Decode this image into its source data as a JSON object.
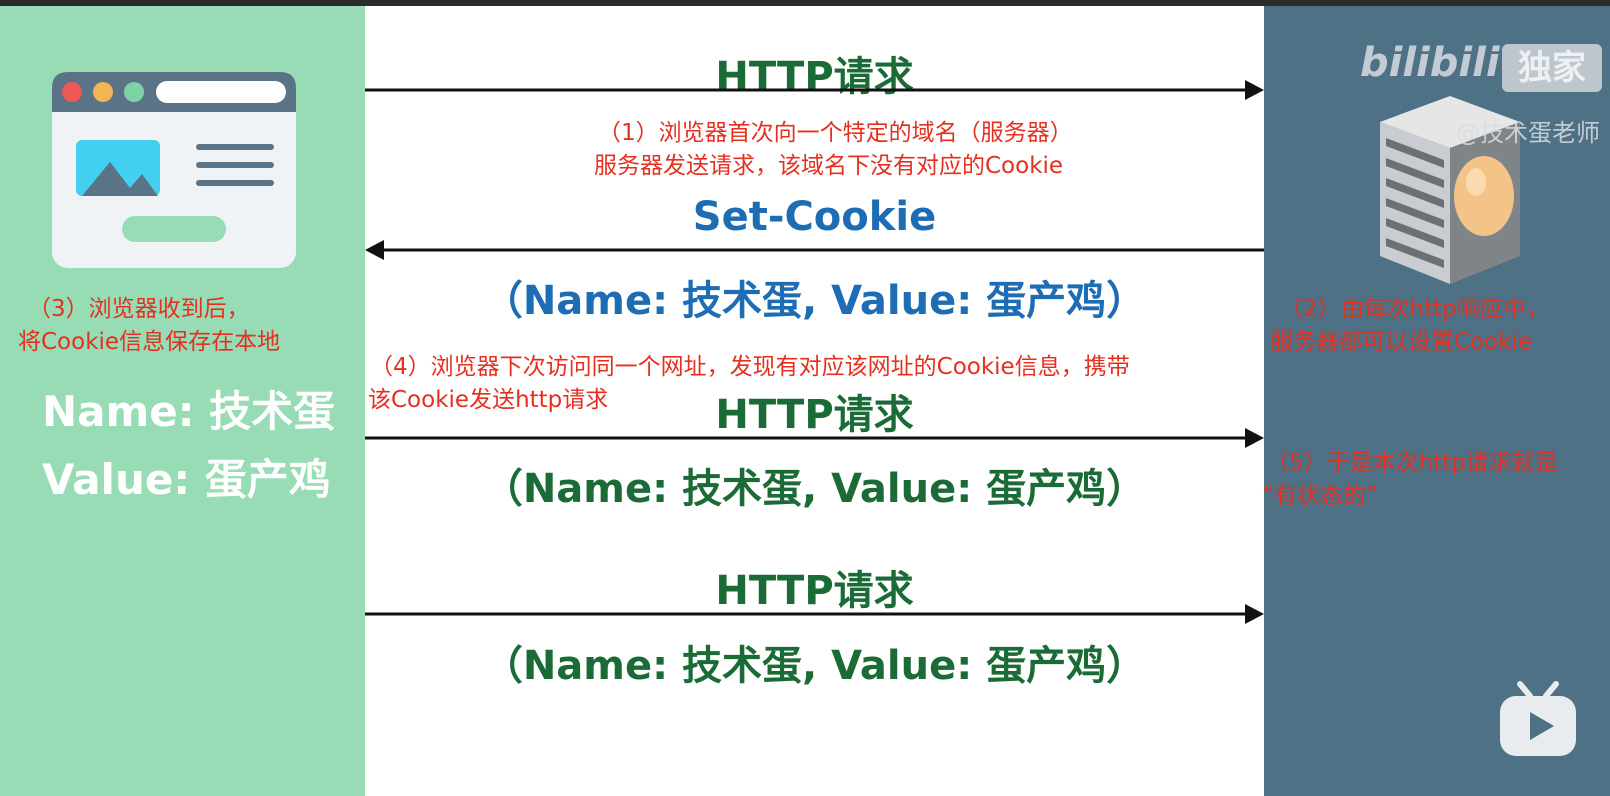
{
  "steps": {
    "step1_line1": "（1）浏览器首次向一个特定的域名（服务器）",
    "step1_line2": "服务器发送请求，该域名下没有对应的Cookie",
    "step2_line1": "（2）由每次http响应中，",
    "step2_line2": "服务器都可以设置Cookie",
    "step3_line1": "（3）浏览器收到后，",
    "step3_line2": "将Cookie信息保存在本地",
    "step4_line1": "（4）浏览器下次访问同一个网址，发现有对应该网址的Cookie信息，携带",
    "step4_line2": "该Cookie发送http请求",
    "step5_line1": "（5）于是本次http请求就是",
    "step5_line2": "“有状态的”"
  },
  "arrows": {
    "request1_label": "HTTP请求",
    "response_label": "Set-Cookie",
    "response_cookie": "（Name: 技术蛋, Value: 蛋产鸡）",
    "request2_label": "HTTP请求",
    "request2_cookie": "（Name: 技术蛋, Value: 蛋产鸡）",
    "request3_label": "HTTP请求",
    "request3_cookie": "（Name: 技术蛋, Value: 蛋产鸡）"
  },
  "browser_storage": {
    "name_line": "Name: 技术蛋",
    "value_line": "Value: 蛋产鸡"
  },
  "watermark": {
    "logo_text": "bilibili",
    "exclusive": "独家",
    "author": "@技术蛋老师"
  },
  "colors": {
    "left_panel": "#97dcb4",
    "right_panel": "#4f7186",
    "http_green": "#1b6b37",
    "cookie_blue": "#1e6cb3",
    "note_red": "#e53020"
  },
  "icons": {
    "browser": "browser-window-icon",
    "server": "server-rack-icon",
    "play": "bilibili-play-icon"
  }
}
